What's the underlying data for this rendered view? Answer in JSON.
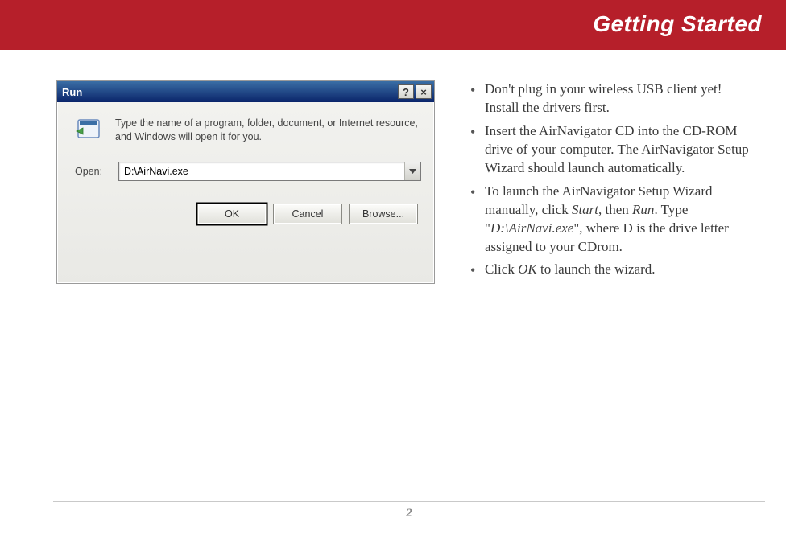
{
  "header": {
    "title": "Getting Started"
  },
  "dialog": {
    "title": "Run",
    "help_btn": "?",
    "close_btn": "×",
    "description": "Type the name of a program, folder, document, or Internet resource, and Windows will open it for you.",
    "open_label": "Open:",
    "open_value": "D:\\AirNavi.exe",
    "buttons": {
      "ok": "OK",
      "cancel": "Cancel",
      "browse": "Browse..."
    }
  },
  "instructions": {
    "b1": "Don't plug in your wireless USB client yet!  Install the drivers first.",
    "b2": "Insert the AirNavigator CD into the CD-ROM drive of your computer. The AirNavigator Setup Wizard should launch automatically.",
    "b3a": "To launch the AirNavigator Setup Wizard manually, click ",
    "b3_start": "Start",
    "b3b": ", then ",
    "b3_run": "Run",
    "b3c": ".  Type \"",
    "b3_path": "D:\\AirNavi.exe",
    "b3d": "\", where D is the drive letter assigned to your CDrom.",
    "b4a": "Click ",
    "b4_ok": "OK",
    "b4b": " to launch the wizard."
  },
  "footer": {
    "page": "2"
  }
}
